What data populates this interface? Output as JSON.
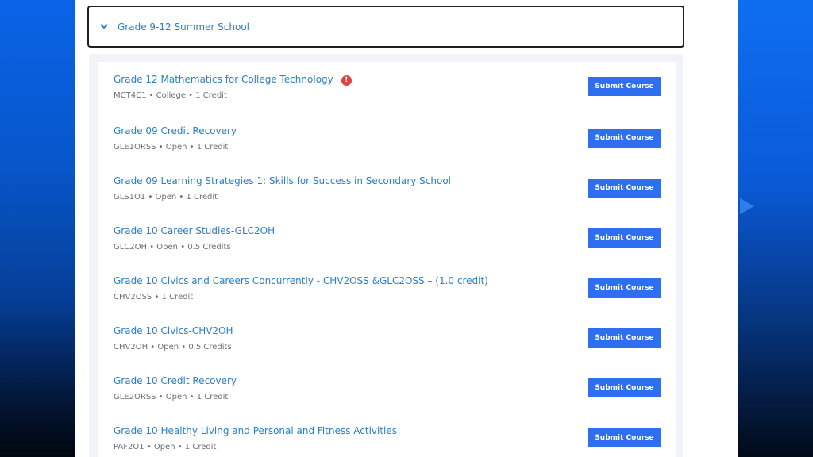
{
  "accordion": {
    "title": "Grade 9-12 Summer School",
    "chevron_icon": "chevron-down-icon"
  },
  "courses": [
    {
      "title": "Grade 12 Mathematics for College Technology",
      "meta": "MCT4C1 • College • 1 Credit",
      "alert": true,
      "button": "Submit Course"
    },
    {
      "title": "Grade 09 Credit Recovery",
      "meta": "GLE1ORSS • Open • 1 Credit",
      "alert": false,
      "button": "Submit Course"
    },
    {
      "title": "Grade 09 Learning Strategies 1: Skills for Success in Secondary School",
      "meta": "GLS1O1 • Open • 1 Credit",
      "alert": false,
      "button": "Submit Course"
    },
    {
      "title": "Grade 10 Career Studies-GLC2OH",
      "meta": "GLC2OH • Open • 0.5 Credits",
      "alert": false,
      "button": "Submit Course"
    },
    {
      "title": "Grade 10 Civics and Careers Concurrently - CHV2OSS &GLC2OSS – (1.0 credit)",
      "meta": "CHV2OSS • 1 Credit",
      "alert": false,
      "button": "Submit Course"
    },
    {
      "title": "Grade 10 Civics-CHV2OH",
      "meta": "CHV2OH • Open • 0.5 Credits",
      "alert": false,
      "button": "Submit Course"
    },
    {
      "title": "Grade 10 Credit Recovery",
      "meta": "GLE2ORSS • Open • 1 Credit",
      "alert": false,
      "button": "Submit Course"
    },
    {
      "title": "Grade 10 Healthy Living and Personal and Fitness Activities",
      "meta": "PAF2O1 • Open • 1 Credit",
      "alert": false,
      "button": "Submit Course"
    }
  ],
  "colors": {
    "link": "#2b7fc9",
    "button": "#2d6ff0",
    "alert": "#e04242"
  }
}
